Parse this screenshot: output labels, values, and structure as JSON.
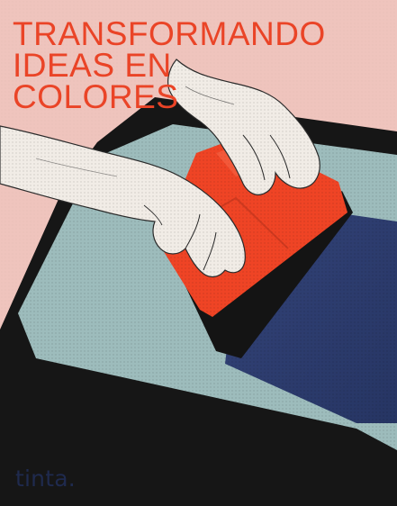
{
  "poster": {
    "headline_lines": [
      "TRANSFORMANDO",
      "IDEAS EN",
      "COLORES"
    ],
    "brand": "tinta."
  },
  "colors": {
    "background": "#efc4bd",
    "headline": "#ea4427",
    "frame": "#161616",
    "screen": "#9dbcbc",
    "ink": "#2d3c6b",
    "squeegee": "#ef4425",
    "skin": "#f1ece6",
    "brand": "#1f2a4e"
  }
}
